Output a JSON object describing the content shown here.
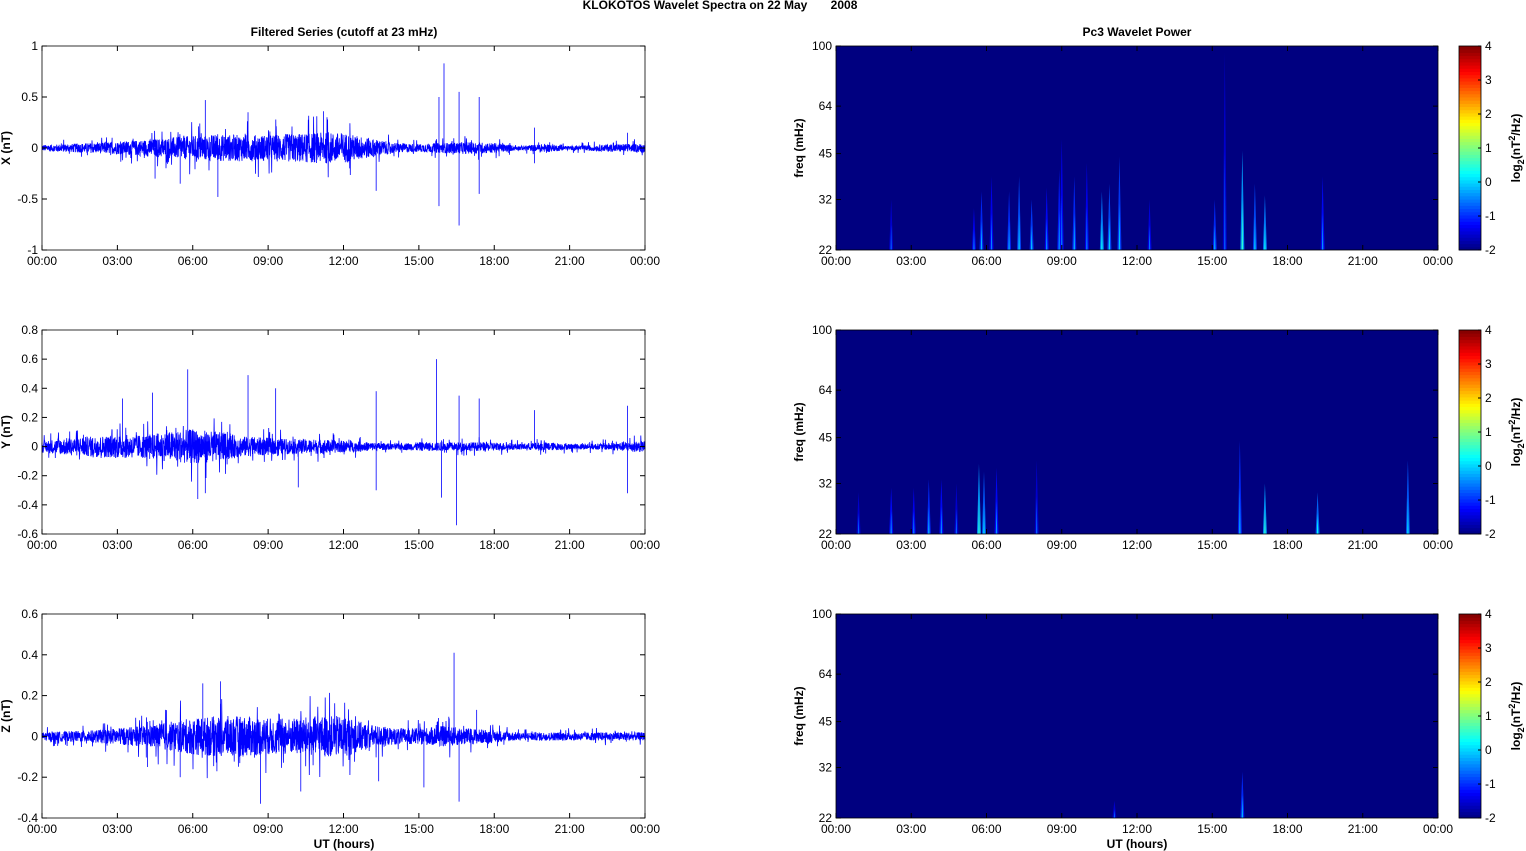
{
  "chart_data": {
    "title": "KLOKOTOS Wavelet Spectra on 22 May       2008",
    "time_ticks": [
      "00:00",
      "03:00",
      "06:00",
      "09:00",
      "12:00",
      "15:00",
      "18:00",
      "21:00",
      "00:00"
    ],
    "x_range_hours": [
      0,
      24
    ],
    "xlabel": "UT (hours)",
    "series_panels": {
      "title": "Filtered Series (cutoff at 23 mHz)",
      "type": "line",
      "color": "#0000ff",
      "panels": [
        {
          "name": "X",
          "ylabel": "X (nT)",
          "ylim": [
            -1,
            1
          ],
          "yticks": [
            "-1",
            "-0.5",
            "0",
            "0.5",
            "1"
          ],
          "ytick_values": [
            -1,
            -0.5,
            0,
            0.5,
            1
          ],
          "envelope_hourly": [
            0.03,
            0.04,
            0.05,
            0.06,
            0.08,
            0.1,
            0.12,
            0.13,
            0.13,
            0.13,
            0.14,
            0.15,
            0.15,
            0.1,
            0.05,
            0.04,
            0.05,
            0.06,
            0.05,
            0.02,
            0.04,
            0.02,
            0.03,
            0.04,
            0.04
          ],
          "spikes": [
            [
              4.5,
              -0.3
            ],
            [
              5.5,
              -0.35
            ],
            [
              6.5,
              0.47
            ],
            [
              7,
              -0.48
            ],
            [
              8.2,
              0.35
            ],
            [
              11.2,
              0.36
            ],
            [
              13.3,
              -0.42
            ],
            [
              15.8,
              -0.57
            ],
            [
              15.8,
              0.5
            ],
            [
              16,
              0.83
            ],
            [
              16.6,
              -0.76
            ],
            [
              16.6,
              0.55
            ],
            [
              17.4,
              0.5
            ],
            [
              17.4,
              -0.45
            ],
            [
              19.6,
              0.2
            ],
            [
              19.6,
              -0.15
            ],
            [
              23.3,
              0.15
            ]
          ]
        },
        {
          "name": "Y",
          "ylabel": "Y (nT)",
          "ylim": [
            -0.6,
            0.8
          ],
          "yticks": [
            "-0.6",
            "-0.4",
            "-0.2",
            "0",
            "0.2",
            "0.4",
            "0.6",
            "0.8"
          ],
          "ytick_values": [
            -0.6,
            -0.4,
            -0.2,
            0,
            0.2,
            0.4,
            0.6,
            0.8
          ],
          "envelope_hourly": [
            0.04,
            0.06,
            0.07,
            0.08,
            0.08,
            0.1,
            0.12,
            0.1,
            0.07,
            0.06,
            0.05,
            0.05,
            0.04,
            0.03,
            0.02,
            0.03,
            0.03,
            0.03,
            0.03,
            0.02,
            0.03,
            0.02,
            0.02,
            0.03,
            0.04
          ],
          "spikes": [
            [
              3.2,
              0.33
            ],
            [
              4.4,
              0.37
            ],
            [
              5.8,
              0.53
            ],
            [
              6.2,
              -0.36
            ],
            [
              6.5,
              -0.32
            ],
            [
              8.2,
              0.49
            ],
            [
              9.3,
              0.4
            ],
            [
              10.2,
              -0.28
            ],
            [
              13.3,
              0.38
            ],
            [
              13.3,
              -0.3
            ],
            [
              15.7,
              0.6
            ],
            [
              15.9,
              -0.35
            ],
            [
              16.5,
              -0.54
            ],
            [
              16.6,
              0.35
            ],
            [
              17.4,
              0.33
            ],
            [
              19.6,
              0.25
            ],
            [
              23.3,
              0.28
            ],
            [
              23.3,
              -0.32
            ]
          ]
        },
        {
          "name": "Z",
          "ylabel": "Z (nT)",
          "ylim": [
            -0.4,
            0.6
          ],
          "yticks": [
            "-0.4",
            "-0.2",
            "0",
            "0.2",
            "0.4",
            "0.6"
          ],
          "ytick_values": [
            -0.4,
            -0.2,
            0,
            0.2,
            0.4,
            0.6
          ],
          "envelope_hourly": [
            0.02,
            0.025,
            0.03,
            0.04,
            0.05,
            0.07,
            0.09,
            0.1,
            0.1,
            0.09,
            0.09,
            0.1,
            0.1,
            0.06,
            0.04,
            0.04,
            0.05,
            0.04,
            0.03,
            0.02,
            0.02,
            0.02,
            0.02,
            0.02,
            0.02
          ],
          "spikes": [
            [
              4.2,
              -0.15
            ],
            [
              5.5,
              -0.2
            ],
            [
              6.4,
              0.26
            ],
            [
              7.1,
              0.27
            ],
            [
              8.7,
              -0.33
            ],
            [
              10.3,
              -0.27
            ],
            [
              13.4,
              -0.22
            ],
            [
              15.2,
              -0.25
            ],
            [
              16.4,
              0.41
            ],
            [
              16.6,
              -0.32
            ],
            [
              17.3,
              0.13
            ]
          ]
        }
      ]
    },
    "wavelet_panels": {
      "title": "Pc3 Wavelet Power",
      "type": "heatmap",
      "ylabel": "freq (mHz)",
      "yscale": "log",
      "ylim": [
        22,
        100
      ],
      "yticks": [
        "22",
        "32",
        "45",
        "64",
        "100"
      ],
      "ytick_values": [
        22,
        32,
        45,
        64,
        100
      ],
      "colorbar": {
        "label_main": "log",
        "label_sub": "2",
        "label_rest": "(nT",
        "label_sup": "2",
        "label_end": "/Hz)",
        "range": [
          -2,
          4
        ],
        "ticks": [
          "-2",
          "-1",
          "0",
          "1",
          "2",
          "3",
          "4"
        ]
      },
      "background_value": -2,
      "panels": [
        {
          "name": "X",
          "streaks": [
            [
              2.2,
              32,
              -1.5
            ],
            [
              5.5,
              30,
              -1.3
            ],
            [
              5.8,
              34,
              -1
            ],
            [
              6.2,
              38,
              -1.3
            ],
            [
              6.9,
              34,
              -1
            ],
            [
              7.3,
              38,
              -0.8
            ],
            [
              7.8,
              32,
              -0.9
            ],
            [
              8.4,
              35,
              -1.2
            ],
            [
              8.9,
              40,
              -1.1
            ],
            [
              9.0,
              50,
              -1.3
            ],
            [
              9.5,
              38,
              -1
            ],
            [
              10,
              42,
              -1.3
            ],
            [
              10.6,
              34,
              -0.5
            ],
            [
              10.9,
              36,
              -0.8
            ],
            [
              11.3,
              44,
              -0.9
            ],
            [
              12.5,
              32,
              -1.4
            ],
            [
              15.1,
              32,
              -1
            ],
            [
              15.5,
              95,
              -1.5
            ],
            [
              16.2,
              46,
              -0.3
            ],
            [
              16.7,
              36,
              -0.8
            ],
            [
              17.1,
              33,
              -0.5
            ],
            [
              19.4,
              38,
              -1.2
            ]
          ]
        },
        {
          "name": "Y",
          "streaks": [
            [
              0.9,
              30,
              -1.5
            ],
            [
              2.2,
              31,
              -1.2
            ],
            [
              3.1,
              31,
              -1.3
            ],
            [
              3.7,
              33,
              -1
            ],
            [
              4.2,
              33,
              -1.2
            ],
            [
              4.8,
              32,
              -1.5
            ],
            [
              5.7,
              37,
              -0.3
            ],
            [
              5.9,
              35,
              -0.7
            ],
            [
              6.4,
              36,
              -1.2
            ],
            [
              8,
              38,
              -1.5
            ],
            [
              16.1,
              44,
              -1
            ],
            [
              17.1,
              32,
              -0.3
            ],
            [
              19.2,
              30,
              -0.6
            ],
            [
              22.8,
              38,
              -0.7
            ]
          ]
        },
        {
          "name": "Z",
          "streaks": [
            [
              11.1,
              25,
              -1.5
            ],
            [
              16.2,
              31,
              -1
            ]
          ]
        }
      ]
    }
  }
}
